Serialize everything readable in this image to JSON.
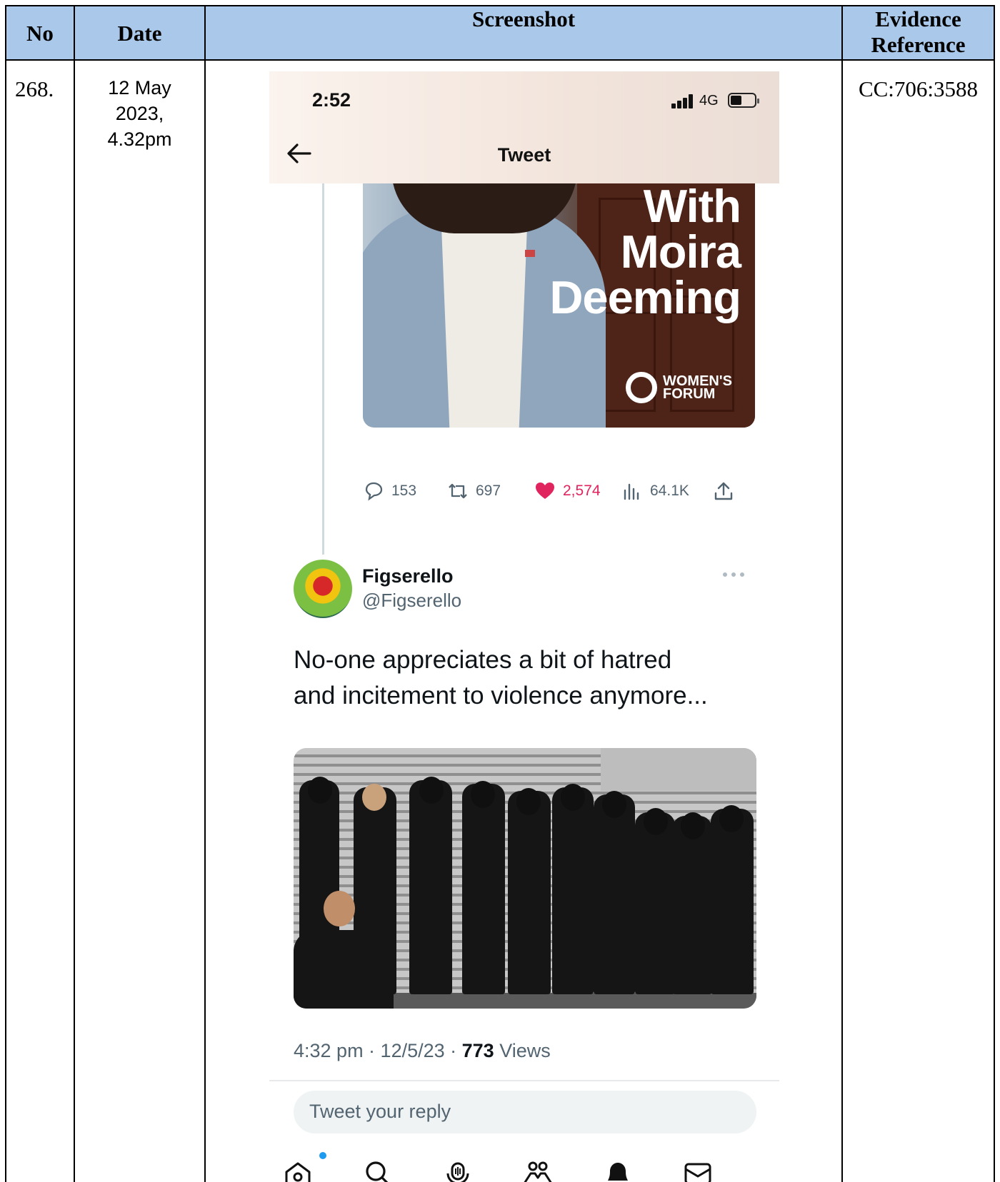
{
  "table": {
    "headers": {
      "no": "No",
      "date": "Date",
      "screenshot": "Screenshot",
      "evidence_line1": "Evidence",
      "evidence_line2": "Reference"
    },
    "row": {
      "no": "268.",
      "date_line1": "12 May",
      "date_line2": "2023,",
      "date_line3": "4.32pm",
      "evidence_ref": "CC:706:3588"
    }
  },
  "phone": {
    "status_time": "2:52",
    "network": "4G",
    "nav_title": "Tweet",
    "promo": {
      "line1": "With",
      "line2": "Moira",
      "line3": "Deeming",
      "logo_line1": "WOMEN'S",
      "logo_line2": "FORUM"
    },
    "metrics": {
      "replies": "153",
      "retweets": "697",
      "likes": "2,574",
      "views": "64.1K"
    },
    "reply": {
      "name": "Figserello",
      "handle": "@Figserello",
      "text_line1": "No-one appreciates a bit of hatred",
      "text_line2": "and incitement to violence anymore...",
      "time": "4:32 pm · 12/5/23 · ",
      "views_count": "773",
      "views_label": " Views"
    },
    "reply_placeholder": "Tweet your reply",
    "tabs": [
      "home-icon",
      "search-icon",
      "spaces-icon",
      "communities-icon",
      "bell-icon",
      "mail-icon"
    ],
    "colors": {
      "header_blue": "#a9c8ea",
      "like_pink": "#e0245e",
      "link_blue": "#1d9bf0"
    }
  }
}
